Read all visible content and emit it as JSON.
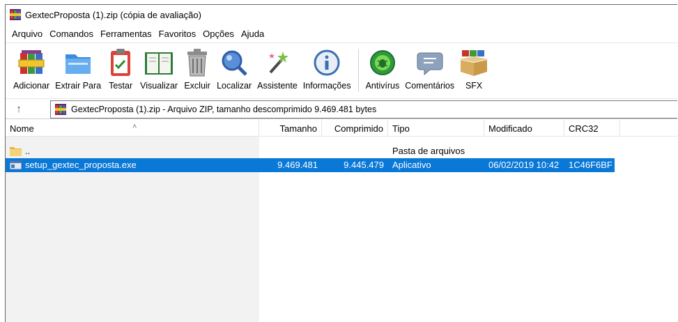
{
  "window": {
    "title": "GextecProposta (1).zip (cópia de avaliação)"
  },
  "menu": [
    "Arquivo",
    "Comandos",
    "Ferramentas",
    "Favoritos",
    "Opções",
    "Ajuda"
  ],
  "toolbar": {
    "buttons": [
      {
        "label": "Adicionar",
        "icon": "add-archive-icon"
      },
      {
        "label": "Extrair Para",
        "icon": "extract-folder-icon"
      },
      {
        "label": "Testar",
        "icon": "test-clipboard-icon"
      },
      {
        "label": "Visualizar",
        "icon": "view-book-icon"
      },
      {
        "label": "Excluir",
        "icon": "trash-icon"
      },
      {
        "label": "Localizar",
        "icon": "magnifier-icon"
      },
      {
        "label": "Assistente",
        "icon": "magic-wand-icon"
      },
      {
        "label": "Informações",
        "icon": "info-icon"
      },
      {
        "label": "Antivírus",
        "icon": "antivirus-bug-icon"
      },
      {
        "label": "Comentários",
        "icon": "comment-icon"
      },
      {
        "label": "SFX",
        "icon": "sfx-box-icon"
      }
    ]
  },
  "address": {
    "up_icon": "up-arrow-icon",
    "path": "GextecProposta (1).zip - Arquivo ZIP, tamanho descomprimido 9.469.481 bytes"
  },
  "list": {
    "columns": {
      "name": "Nome",
      "size": "Tamanho",
      "packed": "Comprimido",
      "type": "Tipo",
      "modified": "Modificado",
      "crc": "CRC32"
    },
    "rows": [
      {
        "name": "..",
        "size": "",
        "packed": "",
        "type": "Pasta de arquivos",
        "modified": "",
        "crc": "",
        "icon": "folder-icon"
      },
      {
        "name": "setup_gextec_proposta.exe",
        "size": "9.469.481",
        "packed": "9.445.479",
        "type": "Aplicativo",
        "modified": "06/02/2019 10:42",
        "crc": "1C46F6BF",
        "icon": "exe-file-icon",
        "selected": true
      }
    ]
  },
  "colors": {
    "selection": "#0a78d7",
    "selection_text": "#ffffff",
    "left_pane_bg": "#f2f2f2"
  }
}
